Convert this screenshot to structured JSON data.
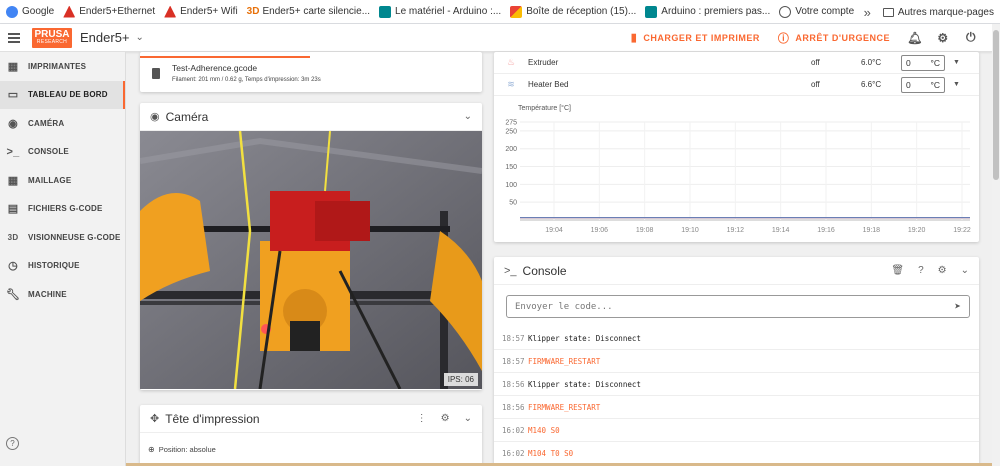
{
  "bookmarks": [
    {
      "label": "Google",
      "color": "#4285f4"
    },
    {
      "label": "Ender5+Ethernet",
      "color": "#d93025"
    },
    {
      "label": "Ender5+ Wifi",
      "color": "#d93025"
    },
    {
      "label": "Ender5+ carte silencie...",
      "color": "#e8710a",
      "prefix": "3D"
    },
    {
      "label": "Le matériel - Arduino :...",
      "color": "#00878f"
    },
    {
      "label": "Boîte de réception (15)...",
      "color": "#ea4335"
    },
    {
      "label": "Arduino : premiers pas...",
      "color": "#00878f"
    },
    {
      "label": "Votre compte",
      "color": "#555555"
    }
  ],
  "bookmarks_other": "Autres marque-pages",
  "header": {
    "logo_top": "PRUSA",
    "logo_bottom": "RESEARCH",
    "printer": "Ender5+",
    "upload_print": "CHARGER ET IMPRIMER",
    "emergency_stop": "ARRÊT D'URGENCE"
  },
  "sidebar": {
    "items": [
      {
        "label": "IMPRIMANTES",
        "icon": "grid-icon"
      },
      {
        "label": "TABLEAU DE BORD",
        "icon": "dashboard-icon"
      },
      {
        "label": "CAMÉRA",
        "icon": "webcam-icon"
      },
      {
        "label": "CONSOLE",
        "icon": "console-icon"
      },
      {
        "label": "MAILLAGE",
        "icon": "mesh-icon"
      },
      {
        "label": "FICHIERS G-CODE",
        "icon": "file-icon"
      },
      {
        "label": "VISIONNEUSE G-CODE",
        "icon": "3d-icon"
      },
      {
        "label": "HISTORIQUE",
        "icon": "history-icon"
      },
      {
        "label": "MACHINE",
        "icon": "wrench-icon"
      }
    ],
    "active_index": 1
  },
  "job": {
    "filename": "Test-Adherence.gcode",
    "meta": "Filament: 201 mm / 0.62 g, Temps d'impression: 3m 23s",
    "progress": 0.5
  },
  "camera": {
    "title": "Caméra",
    "fps": "IPS: 06"
  },
  "toolhead": {
    "title": "Tête d'impression",
    "position": "Position: absolue"
  },
  "temperatures": {
    "rows": [
      {
        "name": "Extruder",
        "state": "off",
        "current": "6.0°C",
        "target": "0",
        "unit": "°C"
      },
      {
        "name": "Heater Bed",
        "state": "off",
        "current": "6.6°C",
        "target": "0",
        "unit": "°C"
      }
    ]
  },
  "chart_data": {
    "type": "line",
    "ylabel": "Température [°C]",
    "ylim": [
      0,
      275
    ],
    "yticks": [
      50,
      100,
      150,
      200,
      250,
      275
    ],
    "xticks": [
      "19:04",
      "19:06",
      "19:08",
      "19:10",
      "19:12",
      "19:14",
      "19:16",
      "19:18",
      "19:20",
      "19:22"
    ],
    "series": [
      {
        "values": [
          6.0,
          6.0,
          6.0,
          6.0,
          6.0,
          6.0,
          6.0,
          6.0,
          6.0,
          6.0
        ],
        "color": "#f4a0a0"
      },
      {
        "values": [
          6.6,
          6.6,
          6.6,
          6.6,
          6.6,
          6.6,
          6.6,
          6.6,
          6.6,
          6.6
        ],
        "color": "#6a7fb5"
      }
    ]
  },
  "console": {
    "title": "Console",
    "placeholder": "Envoyer le code...",
    "lines": [
      {
        "time": "18:57",
        "text": "Klipper state: Disconnect",
        "cmd": false
      },
      {
        "time": "18:57",
        "text": "FIRMWARE_RESTART",
        "cmd": true
      },
      {
        "time": "18:56",
        "text": "Klipper state: Disconnect",
        "cmd": false
      },
      {
        "time": "18:56",
        "text": "FIRMWARE_RESTART",
        "cmd": true
      },
      {
        "time": "16:02",
        "text": "M140 S0",
        "cmd": true
      },
      {
        "time": "16:02",
        "text": "M104 T0 S0",
        "cmd": true
      }
    ]
  },
  "colors": {
    "accent": "#fa6831"
  }
}
